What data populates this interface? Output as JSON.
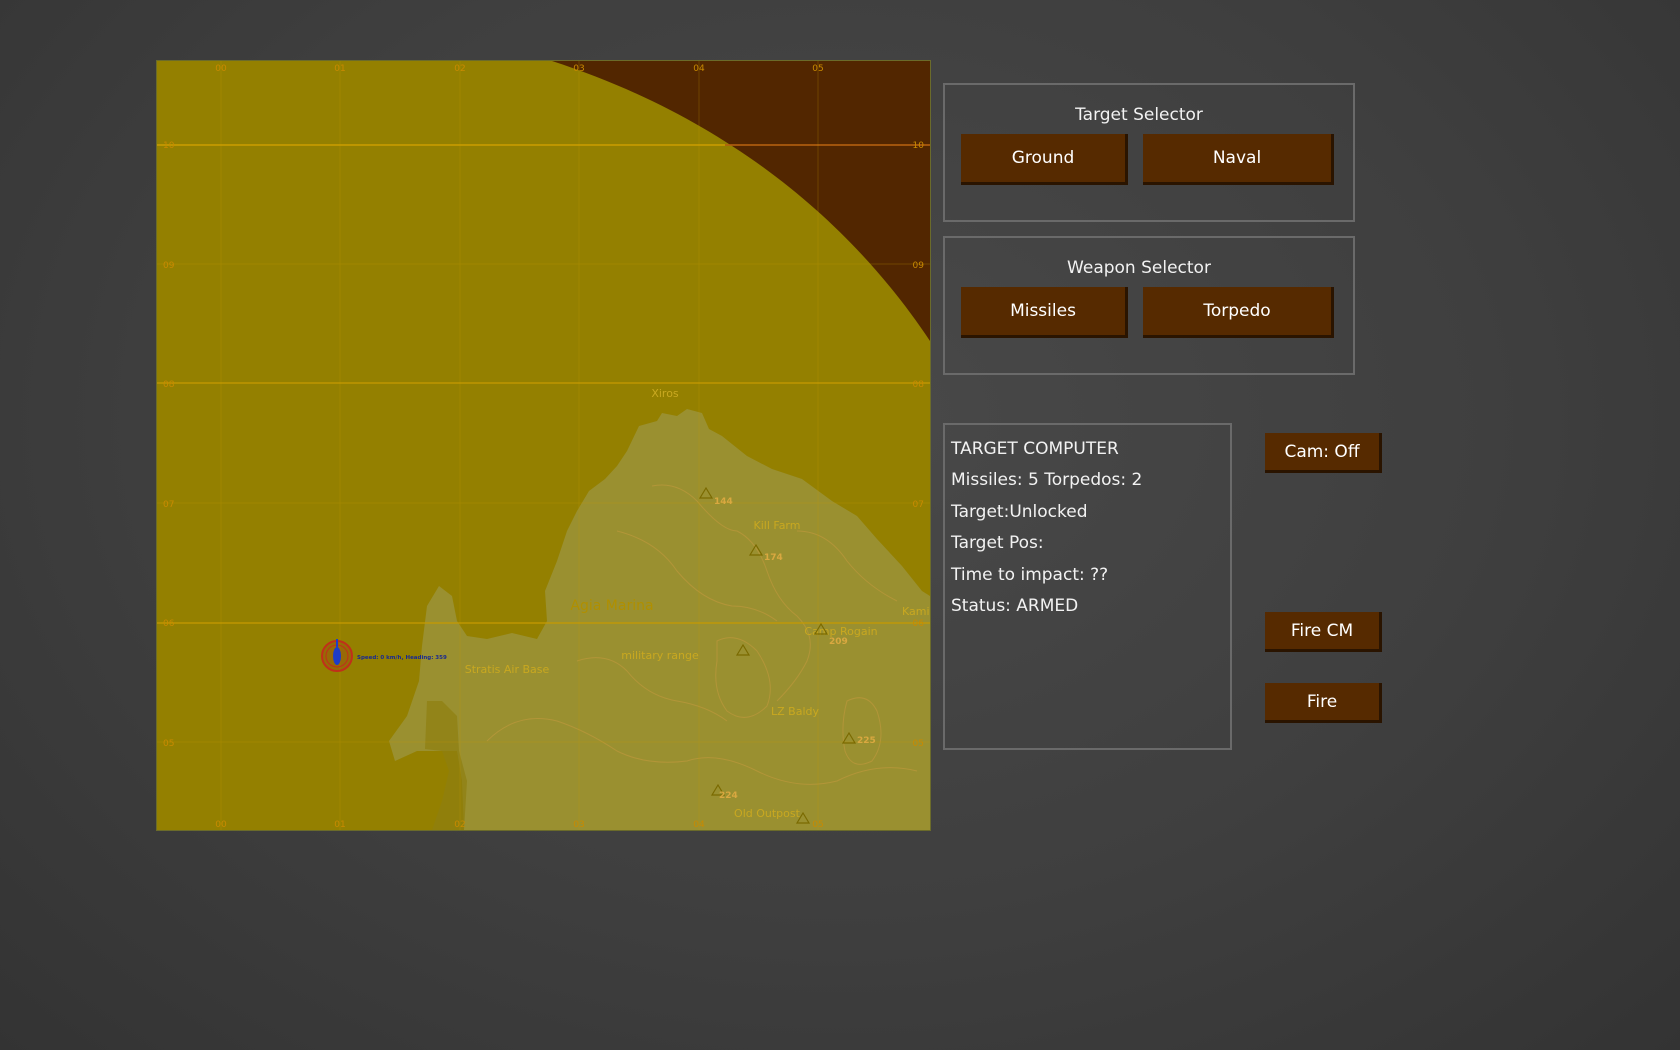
{
  "map": {
    "grid_labels_x": [
      "00",
      "01",
      "02",
      "03",
      "04",
      "05"
    ],
    "grid_labels_y": [
      "10",
      "09",
      "08",
      "07",
      "06",
      "05"
    ],
    "place_names": {
      "xiros": "Xiros",
      "kill_farm": "Kill Farm",
      "agia_marina": "Agia Marina",
      "camp_rogain": "Camp Rogain",
      "kamino": "Kamin",
      "military_range": "military range",
      "stratis_air_base": "Stratis Air Base",
      "lz_baldy": "LZ Baldy",
      "old_outpost": "Old Outpost"
    },
    "elevations": [
      "144",
      "174",
      "209",
      "225",
      "224"
    ],
    "player_marker_label": "Speed: 0 km/h, Heading: 359",
    "colors": {
      "sea": "#948000",
      "land": "#9a9030",
      "outside_range": "#522600",
      "grid_line": "#c79a00",
      "grid_label": "#c98a00"
    }
  },
  "target_selector": {
    "title": "Target Selector",
    "ground_label": "Ground",
    "naval_label": "Naval"
  },
  "weapon_selector": {
    "title": "Weapon Selector",
    "missiles_label": "Missiles",
    "torpedo_label": "Torpedo"
  },
  "target_computer": {
    "heading": "TARGET COMPUTER",
    "ammo": "Missiles: 5 Torpedos: 2",
    "target_state": "Target:Unlocked",
    "target_pos": "Target Pos:",
    "time_to_impact": "Time to impact: ??",
    "status": "Status: ARMED"
  },
  "controls": {
    "cam_label": "Cam: Off",
    "fire_cm_label": "Fire CM",
    "fire_label": "Fire"
  },
  "theme": {
    "button_color": "#562a00",
    "panel_border": "#6a6a6a",
    "background": "#444444"
  }
}
